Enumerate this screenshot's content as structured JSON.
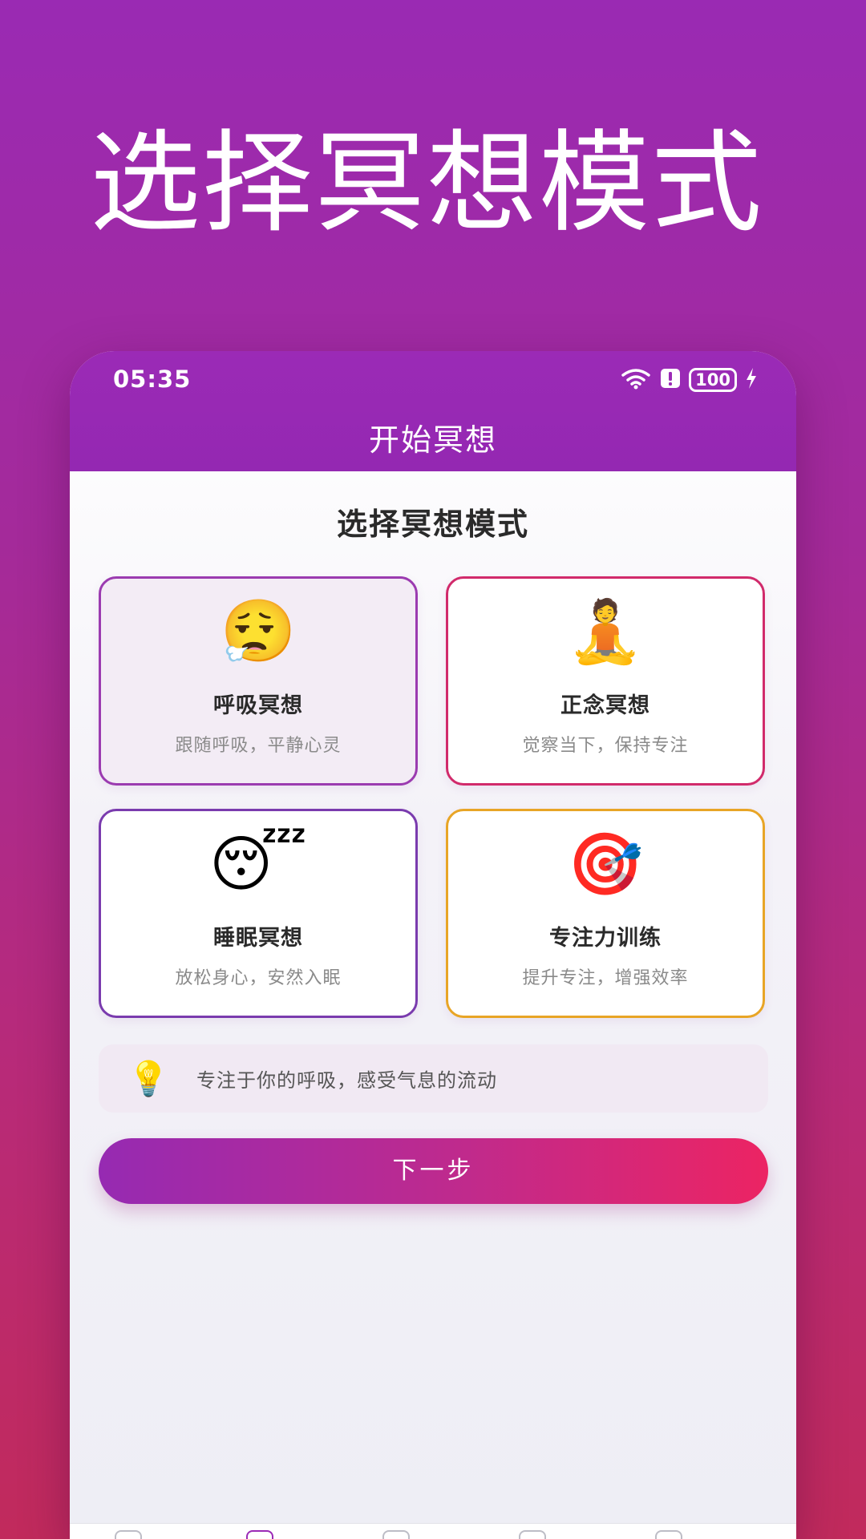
{
  "hero": {
    "title": "选择冥想模式"
  },
  "status_bar": {
    "time": "05:35",
    "battery": "100"
  },
  "app_header": {
    "title": "开始冥想"
  },
  "section": {
    "title": "选择冥想模式"
  },
  "modes": [
    {
      "icon": "breath-icon",
      "emoji": "😮‍💨",
      "title": "呼吸冥想",
      "subtitle": "跟随呼吸，平静心灵",
      "border_color": "#9b3bb0",
      "selected": true
    },
    {
      "icon": "meditation-icon",
      "emoji": "🧘",
      "title": "正念冥想",
      "subtitle": "觉察当下，保持专注",
      "border_color": "#d12a6b",
      "selected": false
    },
    {
      "icon": "sleeping-face-icon",
      "emoji": "😴",
      "title": "睡眠冥想",
      "subtitle": "放松身心，安然入眠",
      "border_color": "#7a3bae",
      "selected": false
    },
    {
      "icon": "target-icon",
      "emoji": "🎯",
      "title": "专注力训练",
      "subtitle": "提升专注，增强效率",
      "border_color": "#e8a526",
      "selected": false
    }
  ],
  "tip": {
    "icon": "light-bulb-icon",
    "emoji": "💡",
    "text": "专注于你的呼吸，感受气息的流动"
  },
  "next_button": {
    "label": "下一步"
  },
  "colors": {
    "primary": "#9b2ab6",
    "accent": "#ec2463"
  }
}
